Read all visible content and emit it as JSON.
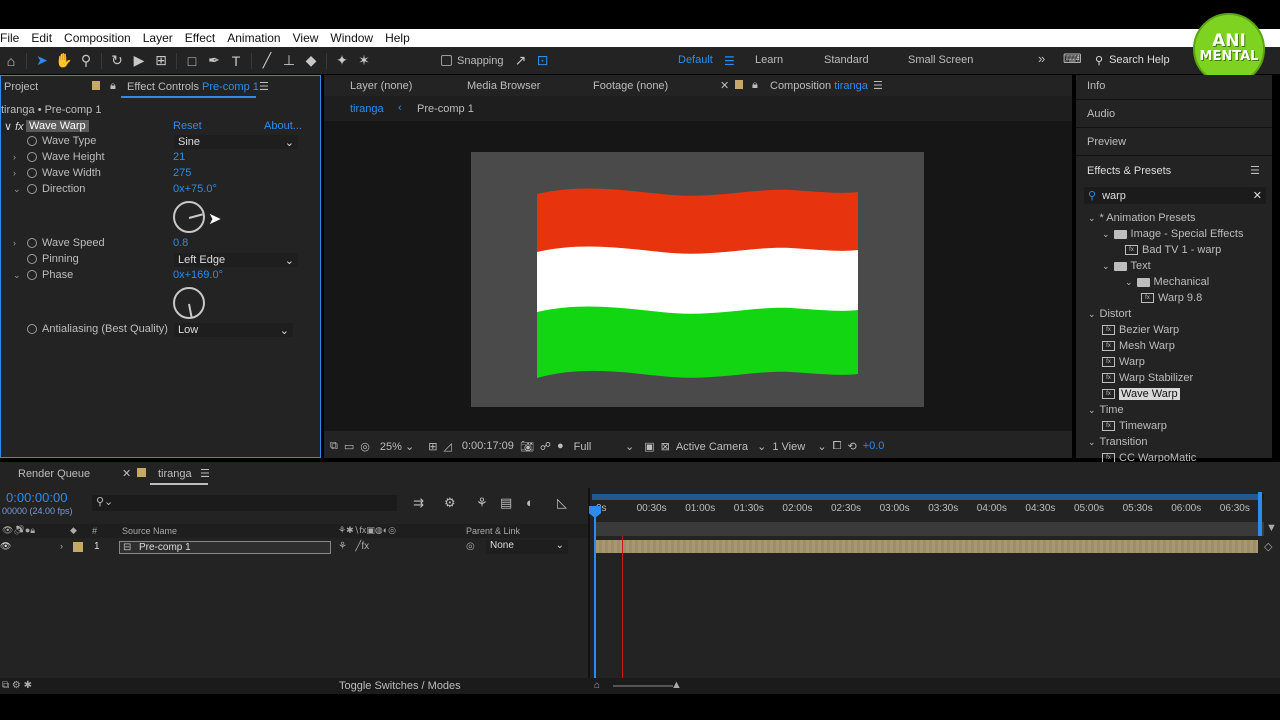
{
  "menu": [
    "File",
    "Edit",
    "Composition",
    "Layer",
    "Effect",
    "Animation",
    "View",
    "Window",
    "Help"
  ],
  "toolbar": {
    "snapping": "Snapping",
    "workspaces": [
      "Default",
      "Learn",
      "Standard",
      "Small Screen"
    ],
    "search_help": "Search Help"
  },
  "logo": {
    "line1": "ANI",
    "line2": "MENTAL",
    "color": "#7ed321"
  },
  "left_panel": {
    "tab_project": "Project",
    "tab_effect_prefix": "Effect Controls",
    "tab_effect_target": "Pre-comp 1",
    "breadcrumb": "tiranga • Pre-comp 1",
    "effect": {
      "name": "Wave Warp",
      "reset": "Reset",
      "about": "About..."
    },
    "props": [
      {
        "label": "Wave Type",
        "value": "Sine"
      },
      {
        "label": "Wave Height",
        "value": "21"
      },
      {
        "label": "Wave Width",
        "value": "275"
      },
      {
        "label": "Direction",
        "value": "0x+75.0°"
      },
      {
        "label": "Wave Speed",
        "value": "0.8"
      },
      {
        "label": "Pinning",
        "value": "Left Edge"
      },
      {
        "label": "Phase",
        "value": "0x+169.0°"
      },
      {
        "label": "Antialiasing (Best Quality)",
        "value": "Low"
      }
    ]
  },
  "viewer": {
    "tabs": [
      "Layer (none)",
      "Media Browser",
      "Footage (none)"
    ],
    "comp_tab_prefix": "Composition",
    "comp_tab_name": "tiranga",
    "crumbs": [
      "tiranga",
      "Pre-comp 1"
    ],
    "zoom": "25%",
    "timecode": "0:00:17:09",
    "resolution": "Full",
    "camera": "Active Camera",
    "views": "1 View",
    "exposure": "+0.0",
    "flag_colors": [
      "#e8330f",
      "#ffffff",
      "#13d613"
    ],
    "bg": "#4a4a4a"
  },
  "right_panel": {
    "items": [
      "Info",
      "Audio",
      "Preview"
    ],
    "effects_title": "Effects & Presets",
    "search": "warp",
    "tree": [
      {
        "label": "* Animation Presets",
        "level": 0,
        "type": "group"
      },
      {
        "label": "Image - Special Effects",
        "level": 1,
        "type": "folder"
      },
      {
        "label": "Bad TV 1 - warp",
        "level": 2,
        "type": "preset"
      },
      {
        "label": "Text",
        "level": 1,
        "type": "folder"
      },
      {
        "label": "Mechanical",
        "level": 2,
        "type": "folder"
      },
      {
        "label": "Warp 9.8",
        "level": 3,
        "type": "preset"
      },
      {
        "label": "Distort",
        "level": 0,
        "type": "group"
      },
      {
        "label": "Bezier Warp",
        "level": 1,
        "type": "effect"
      },
      {
        "label": "Mesh Warp",
        "level": 1,
        "type": "effect"
      },
      {
        "label": "Warp",
        "level": 1,
        "type": "effect"
      },
      {
        "label": "Warp Stabilizer",
        "level": 1,
        "type": "effect"
      },
      {
        "label": "Wave Warp",
        "level": 1,
        "type": "effect",
        "selected": true
      },
      {
        "label": "Time",
        "level": 0,
        "type": "group"
      },
      {
        "label": "Timewarp",
        "level": 1,
        "type": "effect"
      },
      {
        "label": "Transition",
        "level": 0,
        "type": "group"
      },
      {
        "label": "CC WarpoMatic",
        "level": 1,
        "type": "effect"
      }
    ]
  },
  "timeline": {
    "tab_render": "Render Queue",
    "tab_comp": "tiranga",
    "time": "0:00:00:00",
    "fps": "00000 (24.00 fps)",
    "col_source": "Source Name",
    "col_parent": "Parent & Link",
    "layer_num": "1",
    "layer_name": "Pre-comp 1",
    "parent": "None",
    "ruler": [
      "0s",
      "00:30s",
      "01:00s",
      "01:30s",
      "02:00s",
      "02:30s",
      "03:00s",
      "03:30s",
      "04:00s",
      "04:30s",
      "05:00s",
      "05:30s",
      "06:00s",
      "06:30s"
    ],
    "toggle": "Toggle Switches / Modes"
  }
}
